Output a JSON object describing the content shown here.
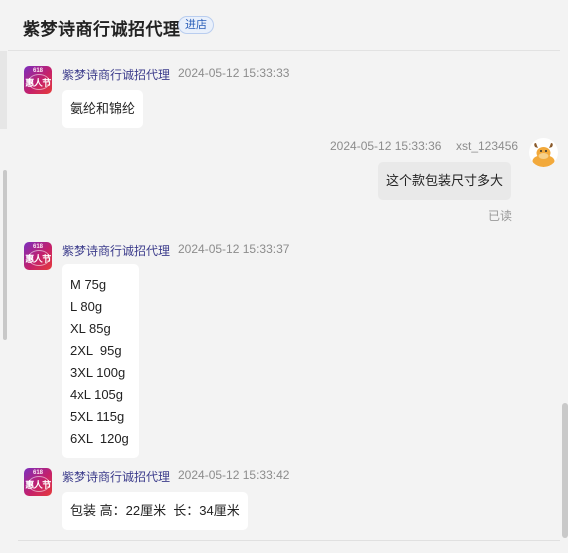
{
  "header": {
    "title": "紫梦诗商行诚招代理",
    "shop_badge": "进店"
  },
  "messages": [
    {
      "sender": "紫梦诗商行诚招代理",
      "time": "2024-05-12 15:33:33",
      "avatar_text_top": "618",
      "avatar_text_main": "惠人节",
      "lines": [
        "氨纶和锦纶"
      ]
    },
    {
      "sender": "xst_123456",
      "time": "2024-05-12 15:33:36",
      "lines": [
        "这个款包装尺寸多大"
      ],
      "status": "已读"
    },
    {
      "sender": "紫梦诗商行诚招代理",
      "time": "2024-05-12 15:33:37",
      "avatar_text_top": "618",
      "avatar_text_main": "惠人节",
      "lines": [
        "M 75g",
        "L 80g",
        "XL 85g",
        "2XL  95g",
        "3XL 100g",
        "4xL 105g",
        "5XL 115g",
        "6XL  120g"
      ]
    },
    {
      "sender": "紫梦诗商行诚招代理",
      "time": "2024-05-12 15:33:42",
      "avatar_text_top": "618",
      "avatar_text_main": "惠人节",
      "lines": [
        "包装 高：22厘米  长：34厘米"
      ]
    }
  ],
  "colors": {
    "background": "#f3f3f3",
    "sender_name": "#3d3d8c",
    "timestamp": "#8c8c8c",
    "badge_text": "#2b5fb9",
    "avatar_gradient_start": "#7b2fbf",
    "avatar_gradient_end": "#e63b3b"
  },
  "icons": {
    "merchant_avatar": "shop-logo-avatar",
    "user_avatar": "cartoon-cow-avatar"
  }
}
